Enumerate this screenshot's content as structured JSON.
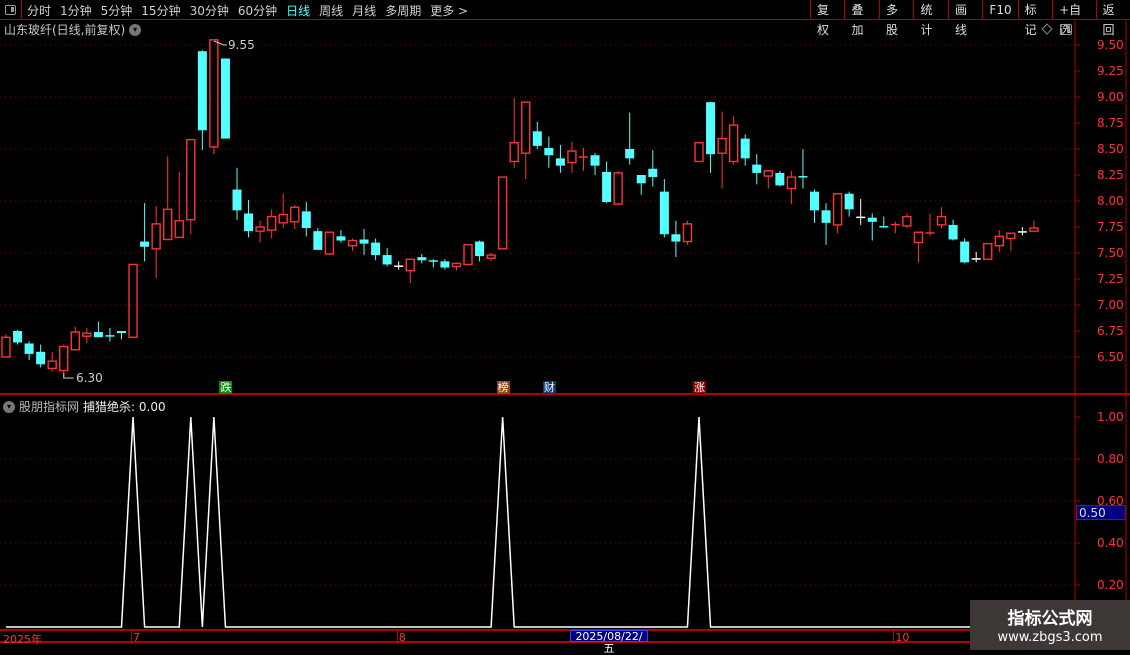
{
  "toolbar": {
    "periods": [
      "分时",
      "1分钟",
      "5分钟",
      "15分钟",
      "30分钟",
      "60分钟",
      "日线",
      "周线",
      "月线",
      "多周期",
      "更多 >"
    ],
    "active": "日线",
    "buttons": [
      "复权",
      "叠加",
      "多股",
      "统计",
      "画线",
      "F10",
      "标记",
      "+自选",
      "返回"
    ]
  },
  "chart": {
    "title": "山东玻纤(日线,前复权)",
    "high_label": "9.55",
    "low_label": "6.30",
    "high_index": 18,
    "low_index": 5,
    "price_ticks": [
      "9.50",
      "9.25",
      "9.00",
      "8.75",
      "8.50",
      "8.25",
      "8.00",
      "7.75",
      "7.50",
      "7.25",
      "7.00",
      "6.75",
      "6.50"
    ],
    "colors": {
      "up": "#ff3232",
      "down": "#54ffff",
      "neutral": "#ffffff",
      "grid": "#8b0000"
    },
    "candles": [
      [
        6.5,
        6.72,
        6.5,
        6.69
      ],
      [
        6.75,
        6.76,
        6.62,
        6.64
      ],
      [
        6.63,
        6.65,
        6.47,
        6.53
      ],
      [
        6.55,
        6.62,
        6.4,
        6.43
      ],
      [
        6.39,
        6.55,
        6.36,
        6.46
      ],
      [
        6.37,
        6.62,
        6.3,
        6.6
      ],
      [
        6.57,
        6.79,
        6.57,
        6.74
      ],
      [
        6.7,
        6.78,
        6.63,
        6.73
      ],
      [
        6.74,
        6.84,
        6.69,
        6.69
      ],
      [
        6.71,
        6.78,
        6.65,
        6.71,
        "c"
      ],
      [
        6.75,
        6.75,
        6.67,
        6.73
      ],
      [
        6.69,
        7.39,
        6.69,
        7.39
      ],
      [
        7.61,
        7.98,
        7.42,
        7.56
      ],
      [
        7.54,
        7.95,
        7.26,
        7.78
      ],
      [
        7.63,
        8.43,
        7.63,
        7.92
      ],
      [
        7.65,
        8.28,
        7.65,
        7.81
      ],
      [
        7.82,
        8.59,
        7.68,
        8.59
      ],
      [
        9.44,
        9.45,
        8.49,
        8.68
      ],
      [
        8.52,
        9.55,
        8.45,
        9.55
      ],
      [
        9.37,
        9.37,
        8.6,
        8.6
      ],
      [
        8.11,
        8.32,
        7.82,
        7.91
      ],
      [
        7.88,
        8.01,
        7.65,
        7.71
      ],
      [
        7.71,
        7.81,
        7.6,
        7.75
      ],
      [
        7.72,
        7.92,
        7.64,
        7.85
      ],
      [
        7.79,
        8.07,
        7.74,
        7.87
      ],
      [
        7.8,
        7.96,
        7.73,
        7.94
      ],
      [
        7.9,
        7.99,
        7.66,
        7.74
      ],
      [
        7.71,
        7.74,
        7.53,
        7.53
      ],
      [
        7.49,
        7.7,
        7.48,
        7.7
      ],
      [
        7.66,
        7.72,
        7.6,
        7.62
      ],
      [
        7.57,
        7.64,
        7.52,
        7.62
      ],
      [
        7.63,
        7.73,
        7.48,
        7.59
      ],
      [
        7.6,
        7.64,
        7.43,
        7.48
      ],
      [
        7.48,
        7.55,
        7.37,
        7.39
      ],
      [
        7.38,
        7.42,
        7.34,
        7.38,
        "w"
      ],
      [
        7.33,
        7.44,
        7.21,
        7.44
      ],
      [
        7.46,
        7.49,
        7.4,
        7.43
      ],
      [
        7.43,
        7.44,
        7.36,
        7.43,
        "c"
      ],
      [
        7.42,
        7.44,
        7.34,
        7.36
      ],
      [
        7.37,
        7.41,
        7.33,
        7.4
      ],
      [
        7.39,
        7.58,
        7.39,
        7.58
      ],
      [
        7.61,
        7.62,
        7.42,
        7.47
      ],
      [
        7.45,
        7.5,
        7.42,
        7.48
      ],
      [
        7.54,
        8.23,
        7.54,
        8.23
      ],
      [
        8.38,
        8.99,
        8.32,
        8.56
      ],
      [
        8.46,
        8.95,
        8.21,
        8.95
      ],
      [
        8.67,
        8.76,
        8.5,
        8.53
      ],
      [
        8.51,
        8.62,
        8.32,
        8.44
      ],
      [
        8.41,
        8.54,
        8.27,
        8.34
      ],
      [
        8.37,
        8.57,
        8.27,
        8.48
      ],
      [
        8.43,
        8.51,
        8.29,
        8.43,
        "r"
      ],
      [
        8.44,
        8.46,
        8.25,
        8.34
      ],
      [
        8.28,
        8.38,
        7.98,
        7.99
      ],
      [
        7.97,
        8.29,
        7.96,
        8.27
      ],
      [
        8.5,
        8.85,
        8.35,
        8.41
      ],
      [
        8.25,
        8.25,
        8.06,
        8.17
      ],
      [
        8.31,
        8.49,
        8.14,
        8.23
      ],
      [
        8.09,
        8.21,
        7.65,
        7.68
      ],
      [
        7.68,
        7.81,
        7.46,
        7.61
      ],
      [
        7.61,
        7.81,
        7.58,
        7.78
      ],
      [
        8.38,
        8.56,
        8.38,
        8.56
      ],
      [
        8.95,
        8.95,
        8.27,
        8.45
      ],
      [
        8.46,
        8.86,
        8.12,
        8.6
      ],
      [
        8.38,
        8.82,
        8.35,
        8.73
      ],
      [
        8.6,
        8.64,
        8.34,
        8.41
      ],
      [
        8.35,
        8.45,
        8.16,
        8.27
      ],
      [
        8.24,
        8.3,
        8.12,
        8.29
      ],
      [
        8.27,
        8.29,
        8.14,
        8.15
      ],
      [
        8.12,
        8.29,
        7.97,
        8.23
      ],
      [
        8.24,
        8.5,
        8.12,
        8.24,
        "c"
      ],
      [
        8.09,
        8.11,
        7.79,
        7.91
      ],
      [
        7.91,
        7.98,
        7.58,
        7.79
      ],
      [
        7.77,
        8.07,
        7.69,
        8.07
      ],
      [
        8.07,
        8.09,
        7.85,
        7.92
      ],
      [
        7.85,
        8.02,
        7.77,
        7.85,
        "w"
      ],
      [
        7.84,
        7.88,
        7.62,
        7.8
      ],
      [
        7.76,
        7.85,
        7.74,
        7.76,
        "c"
      ],
      [
        7.78,
        7.8,
        7.69,
        7.78,
        "r"
      ],
      [
        7.76,
        7.88,
        7.74,
        7.85
      ],
      [
        7.6,
        7.7,
        7.41,
        7.7
      ],
      [
        7.7,
        7.88,
        7.66,
        7.7,
        "r"
      ],
      [
        7.77,
        7.94,
        7.74,
        7.85
      ],
      [
        7.77,
        7.82,
        7.62,
        7.63
      ],
      [
        7.61,
        7.64,
        7.4,
        7.41
      ],
      [
        7.45,
        7.51,
        7.41,
        7.45,
        "w"
      ],
      [
        7.44,
        7.59,
        7.44,
        7.59
      ],
      [
        7.57,
        7.72,
        7.51,
        7.66
      ],
      [
        7.64,
        7.69,
        7.52,
        7.69
      ],
      [
        7.71,
        7.75,
        7.67,
        7.71,
        "w"
      ],
      [
        7.71,
        7.81,
        7.71,
        7.74
      ]
    ],
    "signals": [
      {
        "text": "跌",
        "index": 19,
        "color": "#0a8a0a"
      },
      {
        "text": "榜",
        "index": 43,
        "color": "#8b4a0a"
      },
      {
        "text": "财",
        "index": 47,
        "color": "#0a3a7a"
      },
      {
        "text": "涨",
        "index": 60,
        "color": "#8b0000"
      }
    ]
  },
  "indicator": {
    "source": "股朋指标网",
    "name": "捕猎绝杀: 0.00",
    "ticks": [
      "1.00",
      "0.80",
      "0.60",
      "0.40",
      "0.20"
    ],
    "cursor_value": "0.50",
    "spike_indices": [
      11,
      16,
      18,
      43,
      60
    ]
  },
  "xaxis": {
    "labels": [
      {
        "text": "2025年",
        "index": 0
      },
      {
        "text": "7",
        "index": 11
      },
      {
        "text": "8",
        "index": 34
      },
      {
        "text": "10",
        "index": 77
      }
    ],
    "cursor_date": "2025/08/22/五"
  },
  "watermark": {
    "title": "指标公式网",
    "url": "www.zbgs3.com"
  }
}
